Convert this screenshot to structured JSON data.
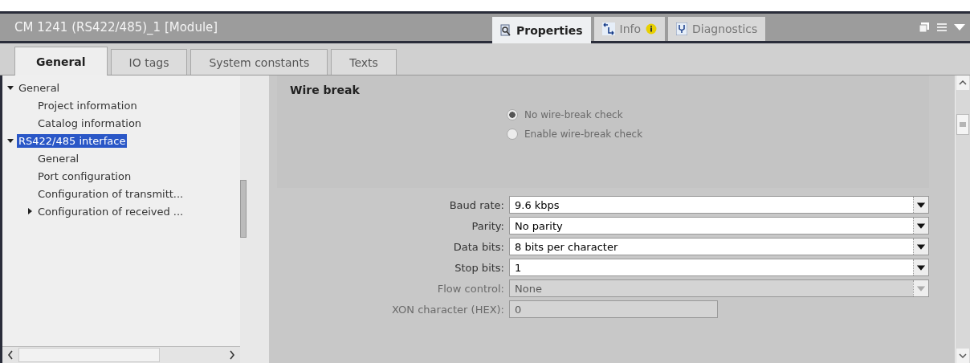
{
  "window": {
    "title": "CM 1241 (RS422/485)_1 [Module]"
  },
  "panel_tabs": [
    {
      "label": "Properties",
      "kind": "properties",
      "selected": true
    },
    {
      "label": "Info",
      "kind": "info",
      "selected": false,
      "badge": true
    },
    {
      "label": "Diagnostics",
      "kind": "diagnostics",
      "selected": false
    }
  ],
  "tabs": [
    {
      "label": "General",
      "selected": true
    },
    {
      "label": "IO tags",
      "selected": false
    },
    {
      "label": "System constants",
      "selected": false
    },
    {
      "label": "Texts",
      "selected": false
    }
  ],
  "tree": [
    {
      "label": "General",
      "expanded": true,
      "selected": false,
      "children": [
        {
          "label": "Project information",
          "selected": false
        },
        {
          "label": "Catalog information",
          "selected": false
        }
      ]
    },
    {
      "label": "RS422/485 interface",
      "expanded": true,
      "selected": true,
      "children": [
        {
          "label": "General",
          "selected": false
        },
        {
          "label": "Port configuration",
          "selected": false
        },
        {
          "label": "Configuration of transmitt...",
          "selected": false
        },
        {
          "label": "Configuration of received ...",
          "expanded": false,
          "selected": false
        }
      ]
    }
  ],
  "wire_break": {
    "title": "Wire break",
    "options": [
      {
        "label": "No wire-break check",
        "selected": true,
        "disabled": true
      },
      {
        "label": "Enable wire-break check",
        "selected": false,
        "disabled": true
      }
    ]
  },
  "fields": [
    {
      "label": "Baud rate:",
      "value": "9.6 kbps",
      "kind": "dropdown",
      "disabled": false
    },
    {
      "label": "Parity:",
      "value": "No parity",
      "kind": "dropdown",
      "disabled": false
    },
    {
      "label": "Data bits:",
      "value": "8 bits per character",
      "kind": "dropdown",
      "disabled": false
    },
    {
      "label": "Stop bits:",
      "value": "1",
      "kind": "dropdown",
      "disabled": false
    },
    {
      "label": "Flow control:",
      "value": "None",
      "kind": "dropdown",
      "disabled": true
    },
    {
      "label": "XON character (HEX):",
      "value": "0",
      "kind": "text",
      "disabled": true
    }
  ]
}
